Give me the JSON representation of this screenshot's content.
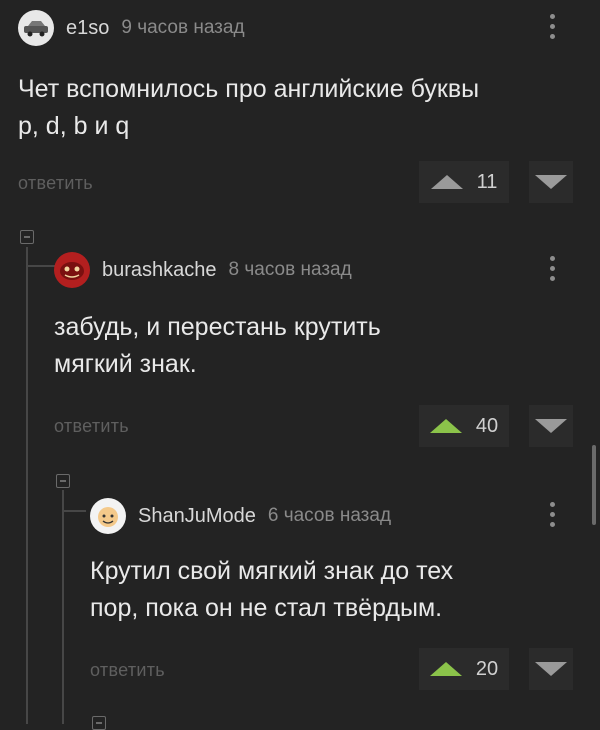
{
  "comments": [
    {
      "username": "e1so",
      "time": "9 часов назад",
      "text_lines": [
        "Чет вспомнилось про английские буквы",
        "p, d, b и q"
      ],
      "reply_label": "ответить",
      "score": "11",
      "upvoted": false
    },
    {
      "username": "burashkache",
      "time": "8 часов назад",
      "text_lines": [
        "забудь, и перестань крутить",
        "мягкий знак."
      ],
      "reply_label": "ответить",
      "score": "40",
      "upvoted": true
    },
    {
      "username": "ShanJuMode",
      "time": "6 часов назад",
      "text_lines": [
        "Крутил свой мягкий знак до тех",
        "пор, пока он не стал твёрдым."
      ],
      "reply_label": "ответить",
      "score": "20",
      "upvoted": true
    }
  ],
  "colors": {
    "background": "#232323",
    "upvote_active": "#8bc34a",
    "vote_inactive": "#9a9a9a"
  }
}
